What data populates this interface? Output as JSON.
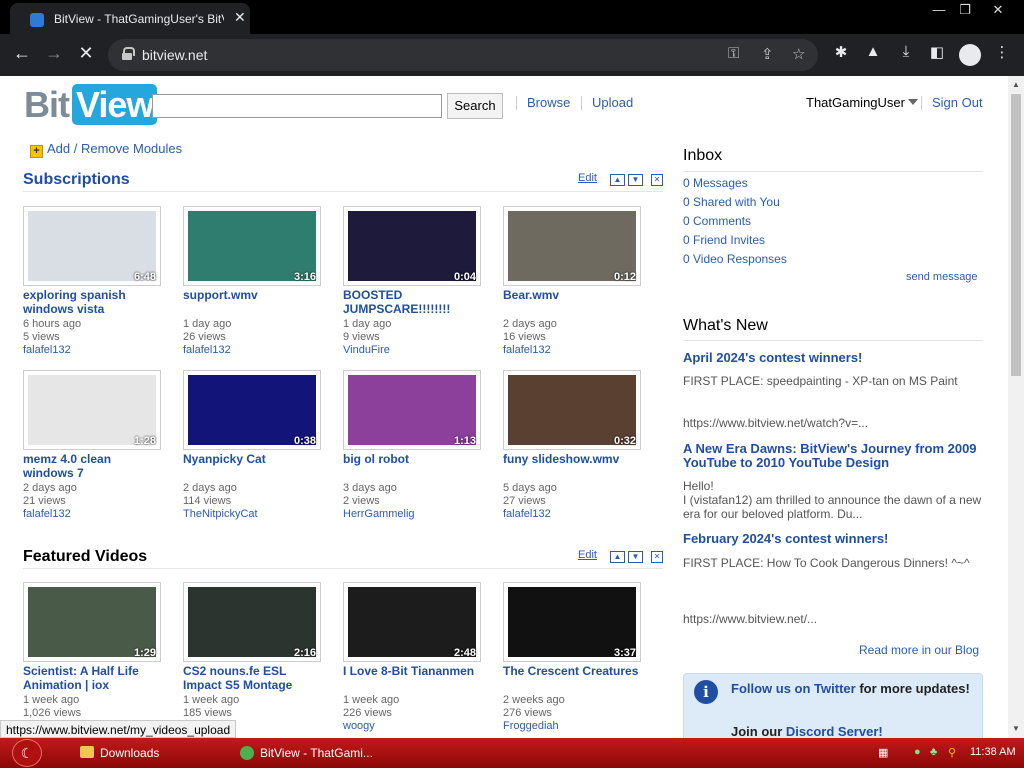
{
  "browser": {
    "tab_title": "BitView - ThatGamingUser's BitV",
    "url": "bitview.net"
  },
  "header": {
    "logo_bit": "Bit",
    "logo_view": "View",
    "search_button": "Search",
    "browse": "Browse",
    "upload": "Upload",
    "username": "ThatGamingUser",
    "sign_out": "Sign Out"
  },
  "add_remove_modules": "Add / Remove Modules",
  "subscriptions": {
    "title": "Subscriptions",
    "edit": "Edit",
    "videos": [
      {
        "title": "exploring spanish windows vista",
        "duration": "6:48",
        "age": "6 hours ago",
        "views": "5 views",
        "uploader": "falafel132",
        "thumb_color": "#d9dde4"
      },
      {
        "title": "support.wmv",
        "duration": "3:16",
        "age": "1 day ago",
        "views": "26 views",
        "uploader": "falafel132",
        "thumb_color": "#2f7d6e"
      },
      {
        "title": "BOOSTED JUMPSCARE!!!!!!!!",
        "duration": "0:04",
        "age": "1 day ago",
        "views": "9 views",
        "uploader": "VinduFire",
        "thumb_color": "#1e1a3c"
      },
      {
        "title": "Bear.wmv",
        "duration": "0:12",
        "age": "2 days ago",
        "views": "16 views",
        "uploader": "falafel132",
        "thumb_color": "#6e6a60"
      },
      {
        "title": "memz 4.0 clean windows 7",
        "duration": "1:28",
        "age": "2 days ago",
        "views": "21 views",
        "uploader": "falafel132",
        "thumb_color": "#e6e6e6"
      },
      {
        "title": "Nyanpicky Cat",
        "duration": "0:38",
        "age": "2 days ago",
        "views": "114 views",
        "uploader": "TheNitpickyCat",
        "thumb_color": "#12147a"
      },
      {
        "title": "big ol robot",
        "duration": "1:13",
        "age": "3 days ago",
        "views": "2 views",
        "uploader": "HerrGammelig",
        "thumb_color": "#8d3f9c"
      },
      {
        "title": "funy slideshow.wmv",
        "duration": "0:32",
        "age": "5 days ago",
        "views": "27 views",
        "uploader": "falafel132",
        "thumb_color": "#5a4030"
      }
    ]
  },
  "featured": {
    "title": "Featured Videos",
    "edit": "Edit",
    "videos": [
      {
        "title": "Scientist: A Half Life Animation | iox",
        "duration": "1:29",
        "age": "1 week ago",
        "views": "1,026 views",
        "uploader": "",
        "thumb_color": "#4a5a48"
      },
      {
        "title": "CS2 nouns.fe ESL Impact S5 Montage",
        "duration": "2:16",
        "age": "1 week ago",
        "views": "185 views",
        "uploader": "",
        "thumb_color": "#2c3430"
      },
      {
        "title": "I Love 8-Bit Tiananmen",
        "duration": "2:48",
        "age": "1 week ago",
        "views": "226 views",
        "uploader": "woogy",
        "thumb_color": "#1c1c1c"
      },
      {
        "title": "The Crescent Creatures",
        "duration": "3:37",
        "age": "2 weeks ago",
        "views": "276 views",
        "uploader": "Froggediah",
        "thumb_color": "#111111"
      }
    ]
  },
  "inbox": {
    "title": "Inbox",
    "items": [
      "0 Messages",
      "0 Shared with You",
      "0 Comments",
      "0 Friend Invites",
      "0 Video Responses"
    ],
    "send_message": "send message"
  },
  "whats_new": {
    "title": "What's New",
    "posts": [
      {
        "title": "April 2024's contest winners!",
        "body": "FIRST PLACE: speedpainting - XP-tan on MS Paint",
        "link": "https://www.bitview.net/watch?v=..."
      },
      {
        "title": "A New Era Dawns: BitView's Journey from 2009 YouTube to 2010 YouTube Design",
        "body": "Hello!\nI (vistafan12) am thrilled to announce the dawn of a new era for our beloved platform. Du...",
        "link": ""
      },
      {
        "title": "February 2024's contest winners!",
        "body": "FIRST PLACE: How To Cook Dangerous Dinners! ^~^",
        "link": "https://www.bitview.net/..."
      }
    ],
    "read_more": "Read more in our Blog"
  },
  "infobox": {
    "twitter_link": "Follow us on Twitter",
    "twitter_rest": " for more updates!",
    "discord_prefix": "Join our ",
    "discord_link": "Discord Server!"
  },
  "status_url": "https://www.bitview.net/my_videos_upload",
  "taskbar": {
    "downloads": "Downloads",
    "browser_task": "BitView - ThatGami...",
    "clock": "11:38 AM"
  }
}
